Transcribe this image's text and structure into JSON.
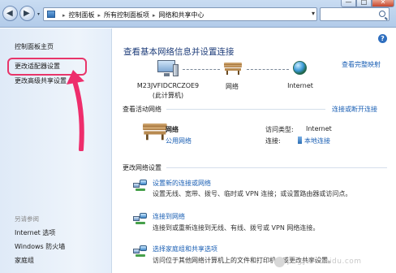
{
  "address_bar": {
    "crumbs": [
      "控制面板",
      "所有控制面板项",
      "网络和共享中心"
    ],
    "search_placeholder": ""
  },
  "window_controls": {
    "minimize": "—",
    "maximize": "□",
    "close": "✕"
  },
  "nav": {
    "back": "◀",
    "forward": "▶",
    "dropdown": "▾",
    "history": "▾"
  },
  "left_pane": {
    "items": [
      {
        "label": "控制面板主页"
      },
      {
        "label": "更改适配器设置"
      },
      {
        "label": "更改高级共享设置"
      }
    ],
    "see_also_title": "另请参阅",
    "see_also": [
      {
        "label": "Internet 选项"
      },
      {
        "label": "Windows 防火墙"
      },
      {
        "label": "家庭组"
      }
    ]
  },
  "main": {
    "help": "?",
    "title": "查看基本网络信息并设置连接",
    "full_map_link": "查看完整映射",
    "map": {
      "computer_name": "M23JVFIDCRCZOE9",
      "computer_sub": "(此计算机)",
      "network_label": "网络",
      "internet_label": "Internet"
    },
    "active": {
      "heading": "查看活动网络",
      "link": "连接或断开连接",
      "network_name": "网络",
      "network_type": "公用网络",
      "access_type_label": "访问类型:",
      "access_type_value": "Internet",
      "connections_label": "连接:",
      "connections_value": "本地连接"
    },
    "change": {
      "heading": "更改网络设置",
      "tasks": [
        {
          "title": "设置新的连接或网络",
          "desc": "设置无线、宽带、拨号、临时或 VPN 连接；或设置路由器或访问点。"
        },
        {
          "title": "连接到网络",
          "desc": "连接到或重新连接到无线、有线、拨号或 VPN 网络连接。"
        },
        {
          "title": "选择家庭组和共享选项",
          "desc": "访问位于其他网络计算机上的文件和打印机，或更改共享设置。"
        }
      ]
    }
  },
  "watermark": {
    "text": "jingyan.baidu.com"
  },
  "colors": {
    "link": "#1a5fb4",
    "title": "#1e3d7a",
    "highlight": "#e8356a"
  }
}
